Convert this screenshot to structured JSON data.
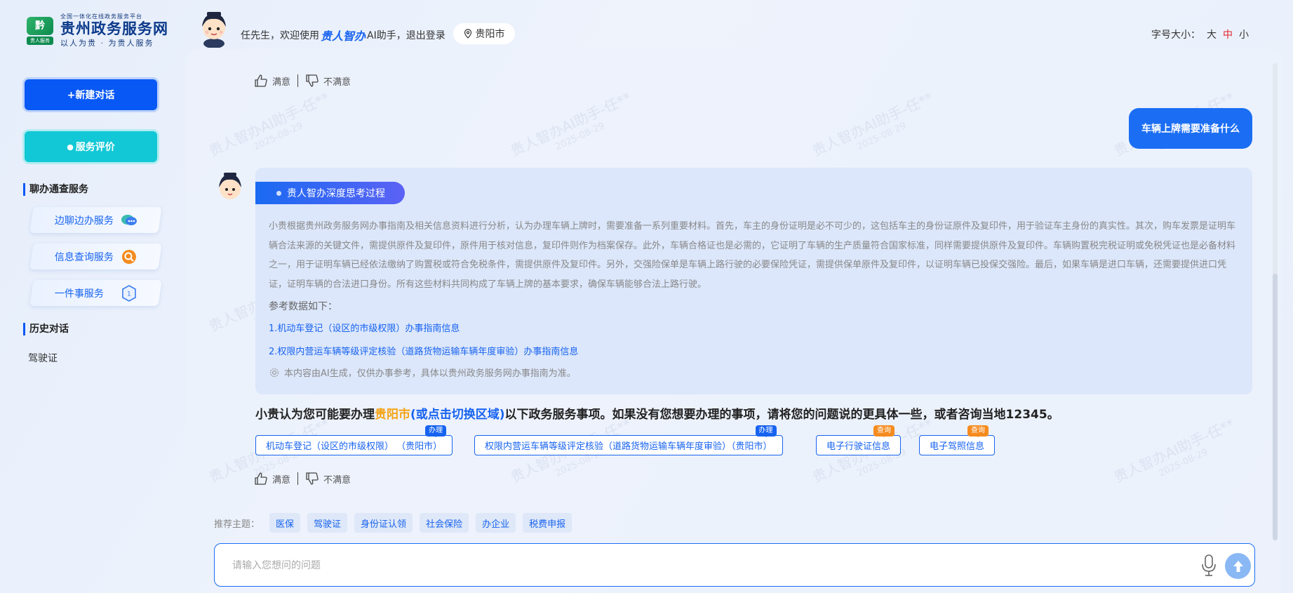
{
  "header": {
    "logo_tiny": "全国一体化在线政务服务平台",
    "logo_mark_top": "黔",
    "logo_mark_bottom": "贵人服务",
    "logo_title": "贵州政务服务网",
    "logo_slogan": "以人为贵 · 为贵人服务",
    "welcome_prefix": "任先生，欢迎使用",
    "welcome_brand": "贵人智办",
    "welcome_suffix": "AI助手，",
    "logout": "退出登录",
    "location": "贵阳市",
    "fontsize_label": "字号大小：",
    "fontsize_options": [
      "大",
      "中",
      "小"
    ],
    "fontsize_selected": "中"
  },
  "sidebar": {
    "new_chat": "+新建对话",
    "rate_service": "服务评价",
    "section_services": "聊办通查服务",
    "services": [
      {
        "label": "边聊边办服务",
        "icon": "chat-icon"
      },
      {
        "label": "信息查询服务",
        "icon": "search-icon"
      },
      {
        "label": "一件事服务",
        "icon": "one-thing-icon"
      }
    ],
    "section_history": "历史对话",
    "history": [
      "驾驶证"
    ]
  },
  "chat": {
    "satisfied": "满意",
    "unsatisfied": "不满意",
    "user_message": "车辆上牌需要准备什么",
    "think_title": "贵人智办深度思考过程",
    "think_text": "小贵根据贵州政务服务网办事指南及相关信息资料进行分析，认为办理车辆上牌时，需要准备一系列重要材料。首先，车主的身份证明是必不可少的，这包括车主的身份证原件及复印件，用于验证车主身份的真实性。其次，购车发票是证明车辆合法来源的关键文件，需提供原件及复印件，原件用于核对信息，复印件则作为档案保存。此外，车辆合格证也是必需的，它证明了车辆的生产质量符合国家标准，同样需要提供原件及复印件。车辆购置税完税证明或免税凭证也是必备材料之一，用于证明车辆已经依法缴纳了购置税或符合免税条件，需提供原件及复印件。另外，交强险保单是车辆上路行驶的必要保险凭证，需提供保单原件及复印件，以证明车辆已投保交强险。最后，如果车辆是进口车辆，还需要提供进口凭证，证明车辆的合法进口身份。所有这些材料共同构成了车辆上牌的基本要求，确保车辆能够合法上路行驶。",
    "ref_title": "参考数据如下：",
    "refs": [
      "1.机动车登记（设区的市级权限）办事指南信息",
      "2.权限内营运车辆等级评定核验（道路货物运输车辆年度审验）办事指南信息"
    ],
    "ai_note": "本内容由AI生成，仅供办事参考，具体以贵州政务服务网办事指南为准。",
    "suggest_prefix": "小贵认为您可能要办理",
    "suggest_city": "贵阳市",
    "suggest_switch": "(或点击切换区域)",
    "suggest_suffix": "以下政务服务事项。如果没有您想要办理的事项，请将您的问题说的更具体一些，或者咨询当地12345。",
    "chips": [
      {
        "label": "机动车登记（设区的市级权限）  （贵阳市）",
        "tag": "办理",
        "tag_color": "#1763f0"
      },
      {
        "label": "权限内营运车辆等级评定核验（道路货物运输车辆年度审验）（贵阳市）",
        "tag": "办理",
        "tag_color": "#1763f0"
      },
      {
        "label": "电子行驶证信息",
        "tag": "查询",
        "tag_color": "#f58b1f"
      },
      {
        "label": "电子驾照信息",
        "tag": "查询",
        "tag_color": "#f58b1f"
      }
    ],
    "watermark_text": "贵人智办AI助手-任**",
    "watermark_date": "2025-08-29"
  },
  "footer": {
    "topics_label": "推荐主题：",
    "topics": [
      "医保",
      "驾驶证",
      "身份证认领",
      "社会保险",
      "办企业",
      "税费申报"
    ],
    "input_placeholder": "请输入您想问的问题"
  },
  "colors": {
    "primary": "#0858f5",
    "teal": "#12c8d6",
    "accent_orange": "#f5a314",
    "selected_red": "#e3242b"
  }
}
